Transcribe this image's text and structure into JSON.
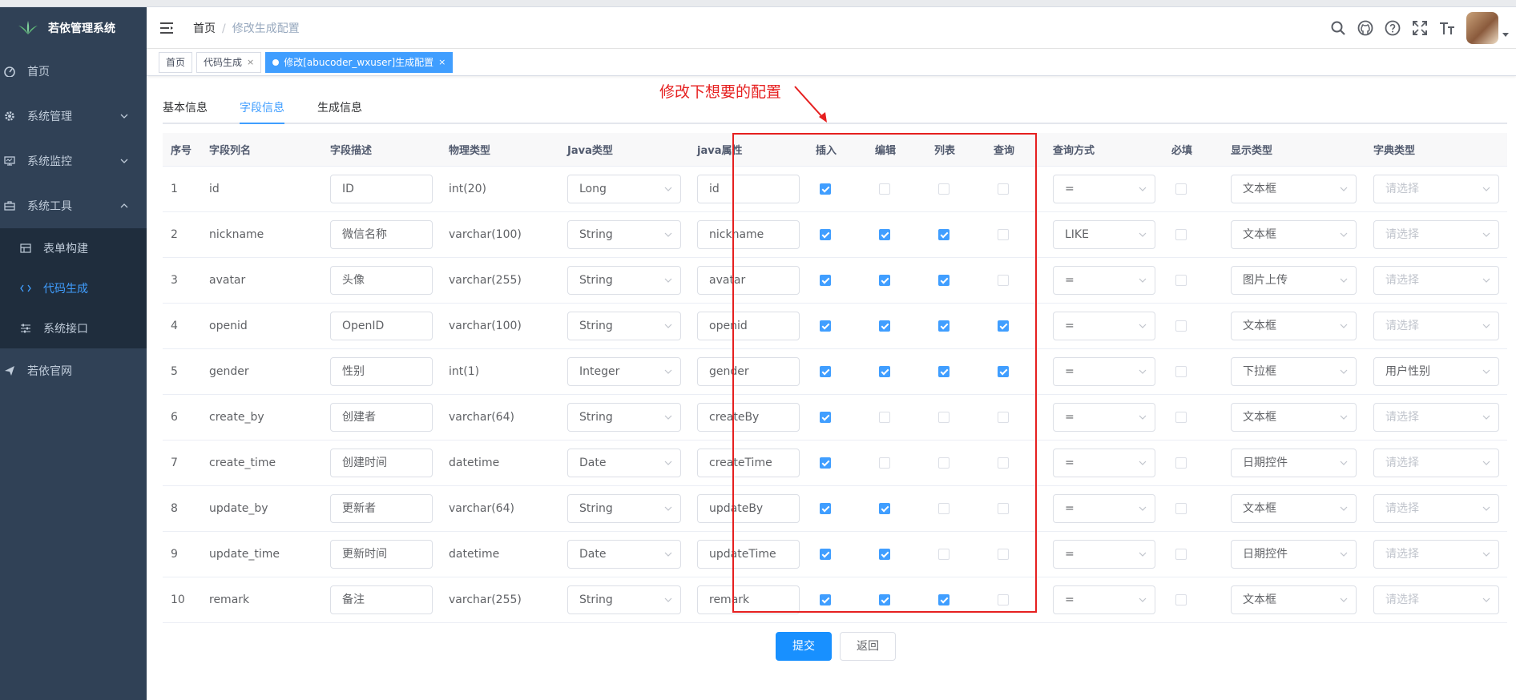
{
  "app": {
    "title": "若依管理系统"
  },
  "sidebar": {
    "items": [
      {
        "label": "首页",
        "icon": "dashboard-icon"
      },
      {
        "label": "系统管理",
        "icon": "gear-icon"
      },
      {
        "label": "系统监控",
        "icon": "monitor-icon"
      },
      {
        "label": "系统工具",
        "icon": "toolbox-icon"
      }
    ],
    "subitems": [
      {
        "label": "表单构建",
        "icon": "form-icon"
      },
      {
        "label": "代码生成",
        "icon": "code-icon"
      },
      {
        "label": "系统接口",
        "icon": "sliders-icon"
      }
    ],
    "external": {
      "label": "若依官网",
      "icon": "paper-plane-icon"
    }
  },
  "breadcrumb": {
    "home": "首页",
    "sep": "/",
    "current": "修改生成配置"
  },
  "tags": [
    {
      "label": "首页"
    },
    {
      "label": "代码生成",
      "close": "×"
    },
    {
      "label": "修改[abucoder_wxuser]生成配置",
      "close": "×"
    }
  ],
  "tabs": [
    "基本信息",
    "字段信息",
    "生成信息"
  ],
  "annotation": "修改下想要的配置",
  "columns": [
    "序号",
    "字段列名",
    "字段描述",
    "物理类型",
    "Java类型",
    "java属性",
    "插入",
    "编辑",
    "列表",
    "查询",
    "查询方式",
    "必填",
    "显示类型",
    "字典类型"
  ],
  "rows": [
    {
      "no": "1",
      "col": "id",
      "desc": "ID",
      "phys": "int(20)",
      "jtype": "Long",
      "jprop": "id",
      "ins": true,
      "edit": false,
      "list": false,
      "query": false,
      "qtype": "=",
      "req": false,
      "show": "文本框",
      "dict": "请选择",
      "dict_ph": true
    },
    {
      "no": "2",
      "col": "nickname",
      "desc": "微信名称",
      "phys": "varchar(100)",
      "jtype": "String",
      "jprop": "nickname",
      "ins": true,
      "edit": true,
      "list": true,
      "query": false,
      "qtype": "LIKE",
      "req": false,
      "show": "文本框",
      "dict": "请选择",
      "dict_ph": true
    },
    {
      "no": "3",
      "col": "avatar",
      "desc": "头像",
      "phys": "varchar(255)",
      "jtype": "String",
      "jprop": "avatar",
      "ins": true,
      "edit": true,
      "list": true,
      "query": false,
      "qtype": "=",
      "req": false,
      "show": "图片上传",
      "dict": "请选择",
      "dict_ph": true
    },
    {
      "no": "4",
      "col": "openid",
      "desc": "OpenID",
      "phys": "varchar(100)",
      "jtype": "String",
      "jprop": "openid",
      "ins": true,
      "edit": true,
      "list": true,
      "query": true,
      "qtype": "=",
      "req": false,
      "show": "文本框",
      "dict": "请选择",
      "dict_ph": true
    },
    {
      "no": "5",
      "col": "gender",
      "desc": "性别",
      "phys": "int(1)",
      "jtype": "Integer",
      "jprop": "gender",
      "ins": true,
      "edit": true,
      "list": true,
      "query": true,
      "qtype": "=",
      "req": false,
      "show": "下拉框",
      "dict": "用户性别",
      "dict_ph": false
    },
    {
      "no": "6",
      "col": "create_by",
      "desc": "创建者",
      "phys": "varchar(64)",
      "jtype": "String",
      "jprop": "createBy",
      "ins": true,
      "edit": false,
      "list": false,
      "query": false,
      "qtype": "=",
      "req": false,
      "show": "文本框",
      "dict": "请选择",
      "dict_ph": true
    },
    {
      "no": "7",
      "col": "create_time",
      "desc": "创建时间",
      "phys": "datetime",
      "jtype": "Date",
      "jprop": "createTime",
      "ins": true,
      "edit": false,
      "list": false,
      "query": false,
      "qtype": "=",
      "req": false,
      "show": "日期控件",
      "dict": "请选择",
      "dict_ph": true
    },
    {
      "no": "8",
      "col": "update_by",
      "desc": "更新者",
      "phys": "varchar(64)",
      "jtype": "String",
      "jprop": "updateBy",
      "ins": true,
      "edit": true,
      "list": false,
      "query": false,
      "qtype": "=",
      "req": false,
      "show": "文本框",
      "dict": "请选择",
      "dict_ph": true
    },
    {
      "no": "9",
      "col": "update_time",
      "desc": "更新时间",
      "phys": "datetime",
      "jtype": "Date",
      "jprop": "updateTime",
      "ins": true,
      "edit": true,
      "list": false,
      "query": false,
      "qtype": "=",
      "req": false,
      "show": "日期控件",
      "dict": "请选择",
      "dict_ph": true
    },
    {
      "no": "10",
      "col": "remark",
      "desc": "备注",
      "phys": "varchar(255)",
      "jtype": "String",
      "jprop": "remark",
      "ins": true,
      "edit": true,
      "list": true,
      "query": false,
      "qtype": "=",
      "req": false,
      "show": "文本框",
      "dict": "请选择",
      "dict_ph": true
    }
  ],
  "buttons": {
    "submit": "提交",
    "back": "返回"
  },
  "colors": {
    "sidebar_bg": "#304156",
    "submenu_bg": "#1f2d3d",
    "accent": "#409eff",
    "annotation": "#e62020"
  }
}
